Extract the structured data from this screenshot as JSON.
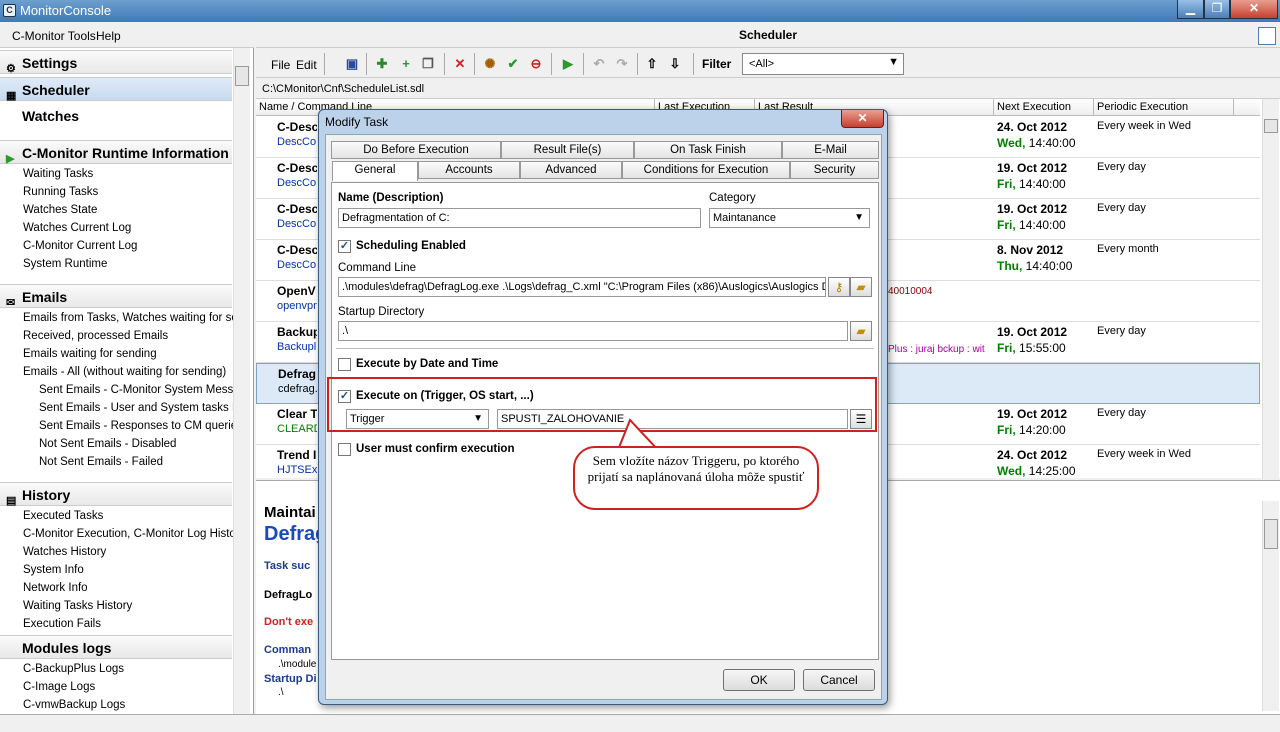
{
  "window": {
    "title": "MonitorConsole",
    "app_icon": "C",
    "minimize": "▁",
    "maximize": "❐",
    "close": "✕"
  },
  "menubar": {
    "tools": "C-Monitor Tools",
    "help": "Help"
  },
  "sidebar": {
    "settings": "Settings",
    "scheduler": "Scheduler",
    "watches": "Watches",
    "runtime": "C-Monitor Runtime Information",
    "runtime_items": [
      "Waiting Tasks",
      "Running Tasks",
      "Watches State",
      "Watches Current Log",
      "C-Monitor Current Log",
      "System Runtime"
    ],
    "emails": "Emails",
    "email_items": [
      "Emails from Tasks, Watches waiting for sending",
      "Received, processed Emails",
      "Emails waiting for sending",
      "Emails - All (without waiting for sending)"
    ],
    "email_sub_items": [
      "Sent Emails - C-Monitor System Messages",
      "Sent Emails - User and System tasks Results",
      "Sent Emails - Responses to CM queries",
      "Not Sent Emails - Disabled",
      "Not Sent Emails - Failed"
    ],
    "history": "History",
    "history_items": [
      "Executed Tasks",
      "C-Monitor Execution, C-Monitor Log History",
      "Watches History",
      "System Info",
      "Network Info",
      "Waiting Tasks History",
      "Execution Fails"
    ],
    "modules": "Modules logs",
    "modules_items": [
      "C-BackupPlus Logs",
      "C-Image Logs",
      "C-vmwBackup Logs"
    ]
  },
  "main": {
    "title": "Scheduler",
    "toolbar": {
      "file": "File",
      "edit": "Edit",
      "filter_label": "Filter",
      "filter_value": "<All>"
    },
    "path": "C:\\CMonitor\\Cnf\\ScheduleList.sdl",
    "columns": [
      "Name / Command Line",
      "Last Execution",
      "Last Result",
      "Next Execution",
      "Periodic Execution"
    ],
    "rows": [
      {
        "name": "C-Desc",
        "desc": "DescCo",
        "next_date": "24. Oct 2012",
        "next_day": "Wed,",
        "next_time": "14:40:00",
        "periodic": "Every week in Wed"
      },
      {
        "name": "C-Desc",
        "desc": "DescCo",
        "next_date": "19. Oct 2012",
        "next_day": "Fri,",
        "next_time": "14:40:00",
        "periodic": "Every day"
      },
      {
        "name": "C-Desc",
        "desc": "DescCo",
        "next_date": "19. Oct 2012",
        "next_day": "Fri,",
        "next_time": "14:40:00",
        "periodic": "Every day"
      },
      {
        "name": "C-Desc",
        "desc": "DescCo",
        "next_date": "8. Nov 2012",
        "next_day": "Thu,",
        "next_time": "14:40:00",
        "periodic": "Every month"
      },
      {
        "name": "OpenV",
        "desc": "openvpn",
        "next_date": "",
        "next_day": "",
        "next_time": "",
        "periodic": "",
        "extra": "40010004"
      },
      {
        "name": "Backup",
        "desc": "Backupl",
        "next_date": "19. Oct 2012",
        "next_day": "Fri,",
        "next_time": "15:55:00",
        "periodic": "Every day",
        "extra": "Plus : juraj bckup : wit"
      },
      {
        "name": "Defrag",
        "desc": "cdefrag.",
        "next_date": "",
        "next_day": "",
        "next_time": "",
        "periodic": ""
      },
      {
        "name": "Clear T",
        "desc": "CLEARD",
        "next_date": "19. Oct 2012",
        "next_day": "Fri,",
        "next_time": "14:20:00",
        "periodic": "Every day"
      },
      {
        "name": "Trend I",
        "desc": "HJTSEx",
        "next_date": "24. Oct 2012",
        "next_day": "Wed,",
        "next_time": "14:25:00",
        "periodic": "Every week in Wed"
      }
    ],
    "detail": {
      "category": "Maintai",
      "name": "Defrag",
      "line1": "Task suc",
      "line2": "DefragLo",
      "line3": "Don't exe",
      "line4": "Comman",
      "line5": ".\\module",
      "line6": "Startup Di",
      "line7": ".\\"
    }
  },
  "dialog": {
    "title": "Modify Task",
    "close": "✕",
    "tabs_row1": [
      "Do Before Execution",
      "Result File(s)",
      "On Task Finish",
      "E-Mail"
    ],
    "tabs_row2": [
      "General",
      "Accounts",
      "Advanced",
      "Conditions for Execution",
      "Security"
    ],
    "name_label": "Name (Description)",
    "name_value": "Defragmentation of C:",
    "category_label": "Category",
    "category_value": "Maintanance",
    "scheduling_enabled": "Scheduling Enabled",
    "command_line_label": "Command Line",
    "command_line_value": ".\\modules\\defrag\\DefragLog.exe .\\Logs\\defrag_C.xml \"C:\\Program Files (x86)\\Auslogics\\Auslogics Di",
    "startup_dir_label": "Startup Directory",
    "startup_dir_value": ".\\",
    "execute_by_date": "Execute by Date and Time",
    "execute_on": "Execute on (Trigger, OS start, ...)",
    "trigger_type": "Trigger",
    "trigger_name": "SPUSTI_ZALOHOVANIE",
    "user_confirm": "User must confirm execution",
    "ok": "OK",
    "cancel": "Cancel"
  },
  "callout": {
    "text": "Sem vložíte názov Triggeru, po ktorého prijatí sa naplánovaná úloha môže spustiť"
  }
}
